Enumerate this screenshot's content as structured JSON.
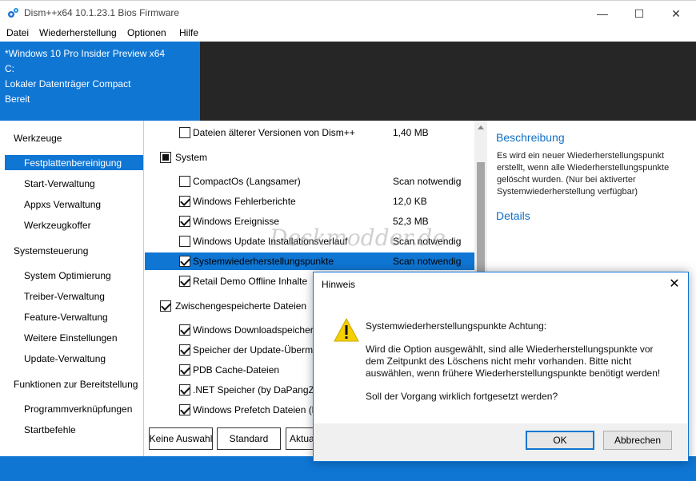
{
  "window": {
    "title": "Dism++x64 10.1.23.1 Bios Firmware",
    "minimize": "—",
    "maximize": "☐",
    "close": "✕"
  },
  "menu": [
    "Datei",
    "Wiederherstellung",
    "Optionen",
    "Hilfe"
  ],
  "status": {
    "line1": "*Windows 10 Pro Insider Preview x64",
    "line2": "C:",
    "line3": "Lokaler Datenträger Compact",
    "line4": "Bereit"
  },
  "sidebar": {
    "groups": [
      {
        "title": "Werkzeuge",
        "items": [
          "Festplattenbereinigung",
          "Start-Verwaltung",
          "Appxs Verwaltung",
          "Werkzeugkoffer"
        ]
      },
      {
        "title": "Systemsteuerung",
        "items": [
          "System Optimierung",
          "Treiber-Verwaltung",
          "Feature-Verwaltung",
          "Weitere Einstellungen",
          "Update-Verwaltung"
        ]
      },
      {
        "title": "Funktionen zur Bereitstellung",
        "items": [
          "Programmverknüpfungen",
          "Startbefehle"
        ]
      }
    ],
    "selected": "Festplattenbereinigung"
  },
  "list": {
    "rows": [
      {
        "label": "Dateien älterer Versionen von Dism++",
        "size": "1,40 MB",
        "checked": false
      },
      {
        "group": true,
        "label": "System",
        "state": "partial"
      },
      {
        "label": "CompactOs (Langsamer)",
        "size": "Scan notwendig",
        "checked": false
      },
      {
        "label": "Windows Fehlerberichte",
        "size": "12,0 KB",
        "checked": true
      },
      {
        "label": "Windows Ereignisse",
        "size": "52,3 MB",
        "checked": true
      },
      {
        "label": "Windows Update Installationsverlauf",
        "size": "Scan notwendig",
        "checked": false
      },
      {
        "label": "Systemwiederherstellungspunkte",
        "size": "Scan notwendig",
        "checked": true,
        "highlighted": true
      },
      {
        "label": "Retail Demo Offline Inhalte",
        "size": "",
        "checked": true
      },
      {
        "group": true,
        "label": "Zwischengespeicherte Dateien",
        "state": "checked"
      },
      {
        "label": "Windows Downloadspeicher",
        "size": "",
        "checked": true
      },
      {
        "label": "Speicher der Update-Übermi",
        "size": "",
        "checked": true
      },
      {
        "label": "PDB Cache-Dateien",
        "size": "",
        "checked": true
      },
      {
        "label": ".NET Speicher (by DaPangZi",
        "size": "",
        "checked": true
      },
      {
        "label": "Windows Prefetch Dateien (b",
        "size": "",
        "checked": true
      }
    ]
  },
  "buttons": {
    "none": "Keine Auswahl",
    "standard": "Standard",
    "update": "Aktua"
  },
  "description": {
    "heading": "Beschreibung",
    "text": "Es wird ein neuer Wiederherstellungspunkt erstellt, wenn alle Wiederherstellungspunkte gelöscht wurden. (Nur bei aktiverter Systemwiederherstellung verfügbar)",
    "details": "Details"
  },
  "watermark": "Deskmodder.de",
  "dialog": {
    "title": "Hinweis",
    "close": "✕",
    "heading": "Systemwiederherstellungspunkte Achtung:",
    "line1": "Wird die Option ausgewählt, sind alle Wiederherstellungspunkte vor",
    "line2": "dem Zeitpunkt des Löschens nicht mehr vorhanden. Bitte nicht",
    "line3": "auswählen, wenn frühere Wiederherstellungspunkte benötigt werden!",
    "question": "Soll der Vorgang wirklich fortgesetzt werden?",
    "ok": "OK",
    "cancel": "Abbrechen"
  },
  "colors": {
    "accent": "#0f76d4",
    "dark_panel": "#262626",
    "link": "#0f6fc6",
    "warning": "#f5d000"
  },
  "icons": [
    "gear-icon",
    "warning-icon",
    "close-icon"
  ]
}
